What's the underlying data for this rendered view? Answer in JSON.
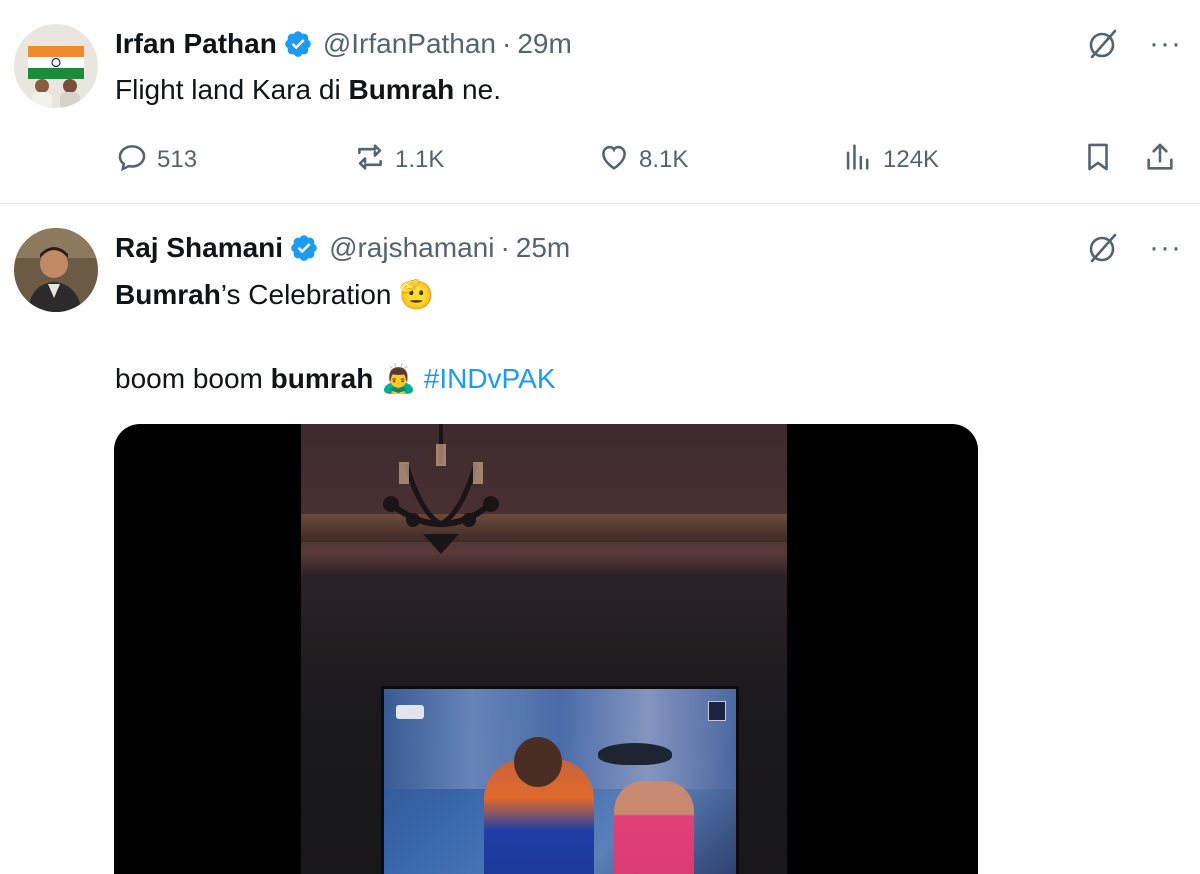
{
  "tweets": [
    {
      "name": "Irfan Pathan",
      "handle": "@IrfanPathan",
      "separator": "·",
      "time": "29m",
      "text_parts": [
        "Flight land Kara di ",
        "Bumrah",
        " ne."
      ],
      "actions": {
        "replies": "513",
        "reposts": "1.1K",
        "likes": "8.1K",
        "views": "124K"
      }
    },
    {
      "name": "Raj Shamani",
      "handle": "@rajshamani",
      "separator": "·",
      "time": "25m",
      "line1_parts": [
        "Bumrah",
        "’s Celebration ",
        "🫡"
      ],
      "line2_parts": [
        "boom boom ",
        "bumrah",
        " 🙇‍♂️ ",
        "#INDvPAK"
      ]
    }
  ],
  "more_label": "···",
  "colors": {
    "verified": "#1d9bf0",
    "hashtag": "#1d9bf0",
    "secondary_text": "#536471",
    "primary_text": "#0f1419",
    "divider": "#e7e9eb"
  },
  "icons": [
    "verified-badge-icon",
    "grok-icon",
    "more-icon",
    "reply-icon",
    "repost-icon",
    "like-icon",
    "views-icon",
    "bookmark-icon",
    "share-icon"
  ]
}
